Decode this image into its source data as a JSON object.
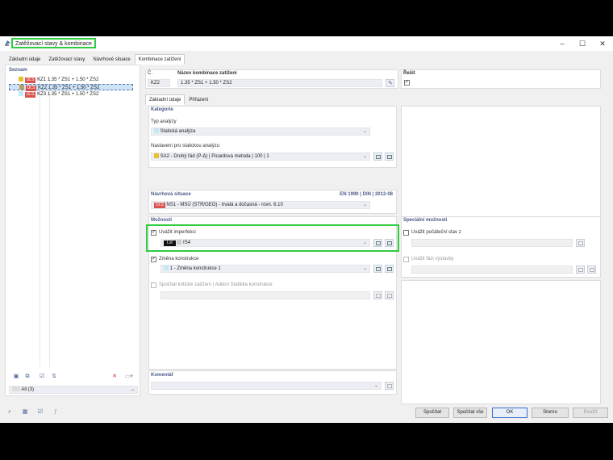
{
  "window": {
    "title": "Zatěžovací stavy & kombinace"
  },
  "tabs": [
    "Základní údaje",
    "Zatěžovací stavy",
    "Návrhové situace",
    "Kombinace zatížení"
  ],
  "list": {
    "header": "Seznam",
    "items": [
      {
        "swatch1": "#e8c030",
        "badge": "ULS",
        "id": "KZ1",
        "formula": "1.35 * ZS1 + 1.50 * ZS2"
      },
      {
        "swatch1": "#b8a060",
        "badge": "ULS",
        "id": "KZ2",
        "formula": "1.35 * ZS1 + 1.50 * ZS2"
      },
      {
        "swatch1": "#c6e8f4",
        "badge": "ULS",
        "id": "KZ3",
        "formula": "1.35 * ZS1 + 1.50 * ZS2"
      }
    ],
    "filter_value": "All (3)"
  },
  "header": {
    "no_label": "Č.",
    "no_value": "KZ2",
    "name_label": "Název kombinace zatížení",
    "name_value": "1.35 * ZS1 + 1.50 * ZS2",
    "solve_label": "Řešit"
  },
  "subtabs": [
    "Základní údaje",
    "Přiřazení"
  ],
  "category": {
    "title": "Kategorie",
    "analysis_type_label": "Typ analýzy",
    "analysis_type_value": "Statická analýza",
    "static_settings_label": "Nastavení pro statickou analýzu",
    "static_settings_value": "SA2 - Druhý řád (P-Δ) | Picardova metoda | 100 | 1"
  },
  "design_situation": {
    "title": "Návrhová situace",
    "standard": "EN 1990 | DIN | 2012-08",
    "badge": "ULS",
    "value": "NS1 - MSÚ (STR/GEO) - trvalá a dočasná - rovn. 6.10"
  },
  "options": {
    "title": "Možnosti",
    "imperfection_label": "Uvážit imperfekci",
    "imperfection_badge": "Lol",
    "imperfection_value": "IS4",
    "structure_mod_label": "Změna konstrukce",
    "structure_mod_value": "1 - Změna konstrukce 1",
    "critical_label": "Spočítat kritické zatížení | Addon Stabilita konstrukce"
  },
  "special": {
    "title": "Speciální možnosti",
    "initial_state_label": "Uvážit počáteční stav z",
    "construction_stage_label": "Uvážit fázi výstavby"
  },
  "comment": {
    "title": "Komentář"
  },
  "buttons": {
    "calculate": "Spočítat",
    "calculate_all": "Spočítat vše",
    "ok": "OK",
    "cancel": "Storno",
    "apply": "Použít"
  },
  "colors": {
    "accent_highlight": "#2ecc40",
    "section_title": "#4a5a8a",
    "uls_badge": "#d9534f",
    "selected_row": "#cfe3f7"
  }
}
